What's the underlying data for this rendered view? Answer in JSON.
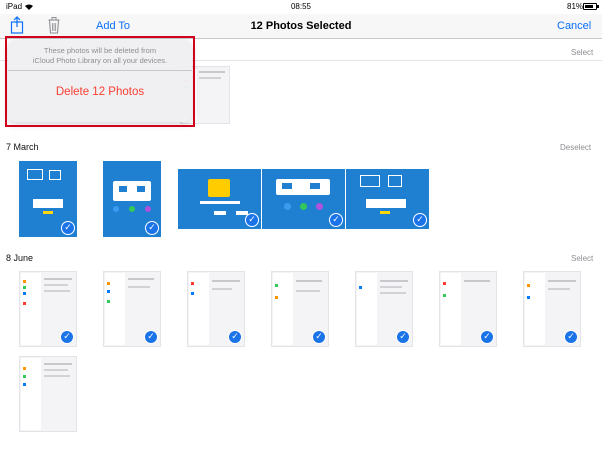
{
  "status_bar": {
    "device": "iPad",
    "time": "08:55",
    "battery": "81%",
    "battery_level": 0.81
  },
  "nav_bar": {
    "add_to_label": "Add To",
    "title": "12 Photos Selected",
    "cancel_label": "Cancel"
  },
  "popover": {
    "message_line1": "These photos will be deleted from",
    "message_line2": "iCloud Photo Library on all your devices.",
    "delete_label": "Delete 12 Photos"
  },
  "sections": [
    {
      "date": "",
      "action": "Select"
    },
    {
      "date": "7 March",
      "action": "Deselect"
    },
    {
      "date": "8 June",
      "action": "Select"
    }
  ],
  "colors": {
    "accent": "#0a6ffb",
    "destructive": "#fa3d31",
    "highlight": "#d0021b",
    "check": "#1a73e8"
  }
}
